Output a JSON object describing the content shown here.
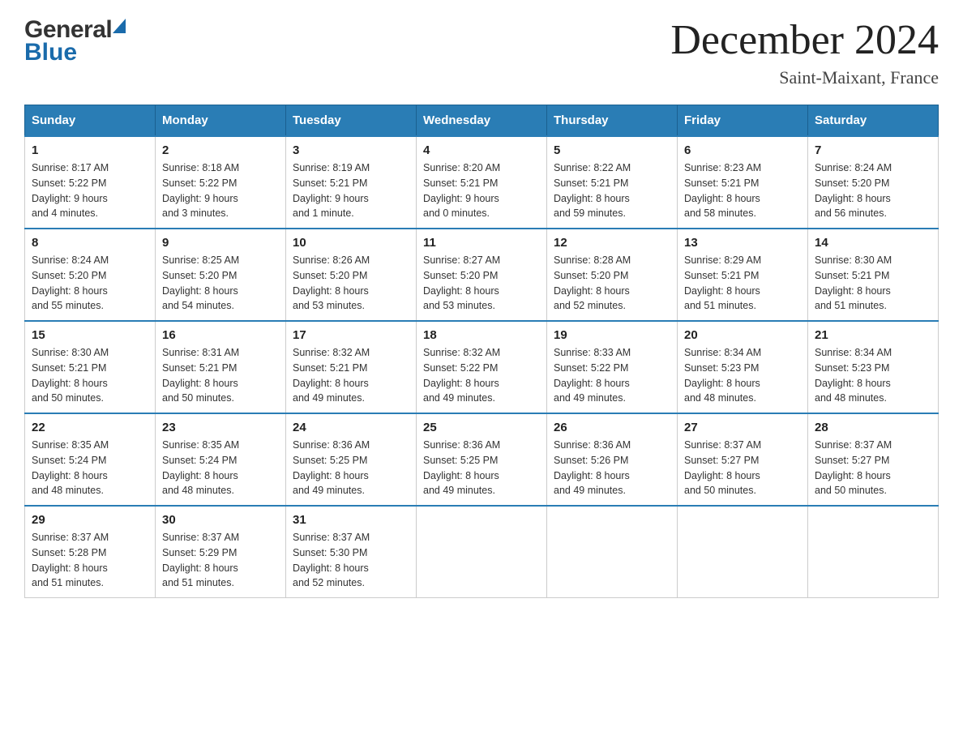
{
  "header": {
    "title": "December 2024",
    "subtitle": "Saint-Maixant, France",
    "logo_general": "General",
    "logo_blue": "Blue"
  },
  "days_of_week": [
    "Sunday",
    "Monday",
    "Tuesday",
    "Wednesday",
    "Thursday",
    "Friday",
    "Saturday"
  ],
  "weeks": [
    [
      {
        "day": "1",
        "sunrise": "8:17 AM",
        "sunset": "5:22 PM",
        "daylight": "9 hours and 4 minutes."
      },
      {
        "day": "2",
        "sunrise": "8:18 AM",
        "sunset": "5:22 PM",
        "daylight": "9 hours and 3 minutes."
      },
      {
        "day": "3",
        "sunrise": "8:19 AM",
        "sunset": "5:21 PM",
        "daylight": "9 hours and 1 minute."
      },
      {
        "day": "4",
        "sunrise": "8:20 AM",
        "sunset": "5:21 PM",
        "daylight": "9 hours and 0 minutes."
      },
      {
        "day": "5",
        "sunrise": "8:22 AM",
        "sunset": "5:21 PM",
        "daylight": "8 hours and 59 minutes."
      },
      {
        "day": "6",
        "sunrise": "8:23 AM",
        "sunset": "5:21 PM",
        "daylight": "8 hours and 58 minutes."
      },
      {
        "day": "7",
        "sunrise": "8:24 AM",
        "sunset": "5:20 PM",
        "daylight": "8 hours and 56 minutes."
      }
    ],
    [
      {
        "day": "8",
        "sunrise": "8:24 AM",
        "sunset": "5:20 PM",
        "daylight": "8 hours and 55 minutes."
      },
      {
        "day": "9",
        "sunrise": "8:25 AM",
        "sunset": "5:20 PM",
        "daylight": "8 hours and 54 minutes."
      },
      {
        "day": "10",
        "sunrise": "8:26 AM",
        "sunset": "5:20 PM",
        "daylight": "8 hours and 53 minutes."
      },
      {
        "day": "11",
        "sunrise": "8:27 AM",
        "sunset": "5:20 PM",
        "daylight": "8 hours and 53 minutes."
      },
      {
        "day": "12",
        "sunrise": "8:28 AM",
        "sunset": "5:20 PM",
        "daylight": "8 hours and 52 minutes."
      },
      {
        "day": "13",
        "sunrise": "8:29 AM",
        "sunset": "5:21 PM",
        "daylight": "8 hours and 51 minutes."
      },
      {
        "day": "14",
        "sunrise": "8:30 AM",
        "sunset": "5:21 PM",
        "daylight": "8 hours and 51 minutes."
      }
    ],
    [
      {
        "day": "15",
        "sunrise": "8:30 AM",
        "sunset": "5:21 PM",
        "daylight": "8 hours and 50 minutes."
      },
      {
        "day": "16",
        "sunrise": "8:31 AM",
        "sunset": "5:21 PM",
        "daylight": "8 hours and 50 minutes."
      },
      {
        "day": "17",
        "sunrise": "8:32 AM",
        "sunset": "5:21 PM",
        "daylight": "8 hours and 49 minutes."
      },
      {
        "day": "18",
        "sunrise": "8:32 AM",
        "sunset": "5:22 PM",
        "daylight": "8 hours and 49 minutes."
      },
      {
        "day": "19",
        "sunrise": "8:33 AM",
        "sunset": "5:22 PM",
        "daylight": "8 hours and 49 minutes."
      },
      {
        "day": "20",
        "sunrise": "8:34 AM",
        "sunset": "5:23 PM",
        "daylight": "8 hours and 48 minutes."
      },
      {
        "day": "21",
        "sunrise": "8:34 AM",
        "sunset": "5:23 PM",
        "daylight": "8 hours and 48 minutes."
      }
    ],
    [
      {
        "day": "22",
        "sunrise": "8:35 AM",
        "sunset": "5:24 PM",
        "daylight": "8 hours and 48 minutes."
      },
      {
        "day": "23",
        "sunrise": "8:35 AM",
        "sunset": "5:24 PM",
        "daylight": "8 hours and 48 minutes."
      },
      {
        "day": "24",
        "sunrise": "8:36 AM",
        "sunset": "5:25 PM",
        "daylight": "8 hours and 49 minutes."
      },
      {
        "day": "25",
        "sunrise": "8:36 AM",
        "sunset": "5:25 PM",
        "daylight": "8 hours and 49 minutes."
      },
      {
        "day": "26",
        "sunrise": "8:36 AM",
        "sunset": "5:26 PM",
        "daylight": "8 hours and 49 minutes."
      },
      {
        "day": "27",
        "sunrise": "8:37 AM",
        "sunset": "5:27 PM",
        "daylight": "8 hours and 50 minutes."
      },
      {
        "day": "28",
        "sunrise": "8:37 AM",
        "sunset": "5:27 PM",
        "daylight": "8 hours and 50 minutes."
      }
    ],
    [
      {
        "day": "29",
        "sunrise": "8:37 AM",
        "sunset": "5:28 PM",
        "daylight": "8 hours and 51 minutes."
      },
      {
        "day": "30",
        "sunrise": "8:37 AM",
        "sunset": "5:29 PM",
        "daylight": "8 hours and 51 minutes."
      },
      {
        "day": "31",
        "sunrise": "8:37 AM",
        "sunset": "5:30 PM",
        "daylight": "8 hours and 52 minutes."
      },
      null,
      null,
      null,
      null
    ]
  ],
  "labels": {
    "sunrise": "Sunrise:",
    "sunset": "Sunset:",
    "daylight": "Daylight:"
  }
}
